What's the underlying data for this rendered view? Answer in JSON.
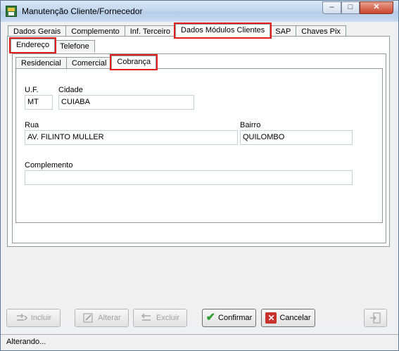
{
  "window": {
    "title": "Manutenção Cliente/Fornecedor",
    "minimize": "–",
    "maximize": "□",
    "close": "✕"
  },
  "tabs_main": [
    {
      "label": "Dados Gerais"
    },
    {
      "label": "Complemento"
    },
    {
      "label": "Inf. Terceiro"
    },
    {
      "label": "Dados Módulos Clientes"
    },
    {
      "label": "SAP"
    },
    {
      "label": "Chaves Pix"
    }
  ],
  "tabs_sub": [
    {
      "label": "Endereço"
    },
    {
      "label": "Telefone"
    }
  ],
  "tabs_addr": [
    {
      "label": "Residencial"
    },
    {
      "label": "Comercial"
    },
    {
      "label": "Cobrança"
    }
  ],
  "form": {
    "uf_label": "U.F.",
    "uf_value": "MT",
    "cidade_label": "Cidade",
    "cidade_value": "CUIABA",
    "rua_label": "Rua",
    "rua_value": "AV. FILINTO MULLER",
    "bairro_label": "Bairro",
    "bairro_value": "QUILOMBO",
    "complemento_label": "Complemento",
    "complemento_value": ""
  },
  "buttons": {
    "incluir": "Incluir",
    "alterar": "Alterar",
    "excluir": "Excluir",
    "confirmar": "Confirmar",
    "cancelar": "Cancelar"
  },
  "status": {
    "text": "Alterando..."
  },
  "icons": {
    "app": "app-icon",
    "incluir": "add-icon",
    "alterar": "edit-icon",
    "excluir": "delete-icon",
    "confirmar": "check-icon",
    "cancelar": "x-icon",
    "exit": "exit-door-icon"
  },
  "colors": {
    "highlight": "#e31c1c",
    "confirm_green": "#2f9d2f",
    "cancel_red": "#c9302c"
  }
}
